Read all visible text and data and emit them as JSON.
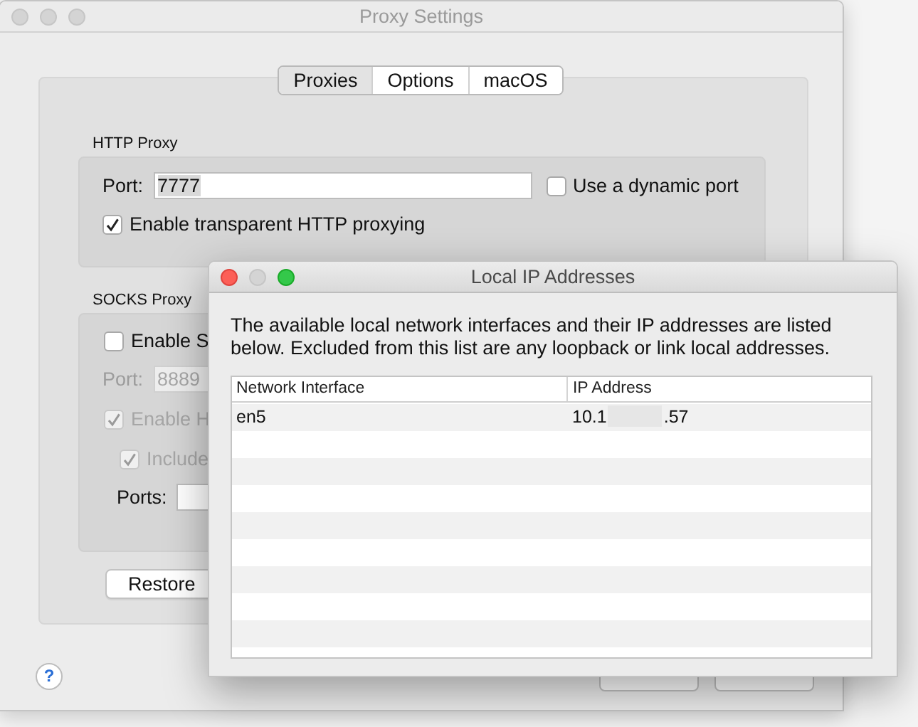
{
  "window": {
    "title": "Proxy Settings",
    "active": false
  },
  "tabs": [
    {
      "label": "Proxies",
      "selected": true
    },
    {
      "label": "Options",
      "selected": false
    },
    {
      "label": "macOS",
      "selected": false
    }
  ],
  "http_proxy": {
    "title": "HTTP Proxy",
    "port": {
      "label": "Port:",
      "value": "7777",
      "disabled": false
    },
    "options": [
      {
        "label": "Use a dynamic port",
        "checked": false,
        "disabled": false
      },
      {
        "label": "Enable transparent HTTP proxying",
        "checked": true,
        "disabled": false
      }
    ]
  },
  "socks_proxy": {
    "title": "SOCKS Proxy",
    "enable": {
      "label": "Enable S",
      "checked": false,
      "disabled": false
    },
    "port": {
      "label": "Port:",
      "value": "8889",
      "disabled": true
    },
    "options": [
      {
        "label": "Enable H",
        "checked": true,
        "disabled": true
      },
      {
        "label": "Include",
        "checked": true,
        "disabled": true
      }
    ],
    "ports": {
      "label": "Ports:",
      "disabled": false
    }
  },
  "restore_button": "Restore",
  "help_button": "?",
  "dialog": {
    "title": "Local IP Addresses",
    "active": true,
    "description": "The available local network interfaces and their IP addresses are listed below.  Excluded from this list are any loopback or link local addresses.",
    "columns": [
      "Network Interface",
      "IP Address"
    ],
    "rows": [
      {
        "interface": "en5",
        "ip_start": "10.1",
        "ip_end": ".57",
        "redacted": true
      }
    ]
  }
}
